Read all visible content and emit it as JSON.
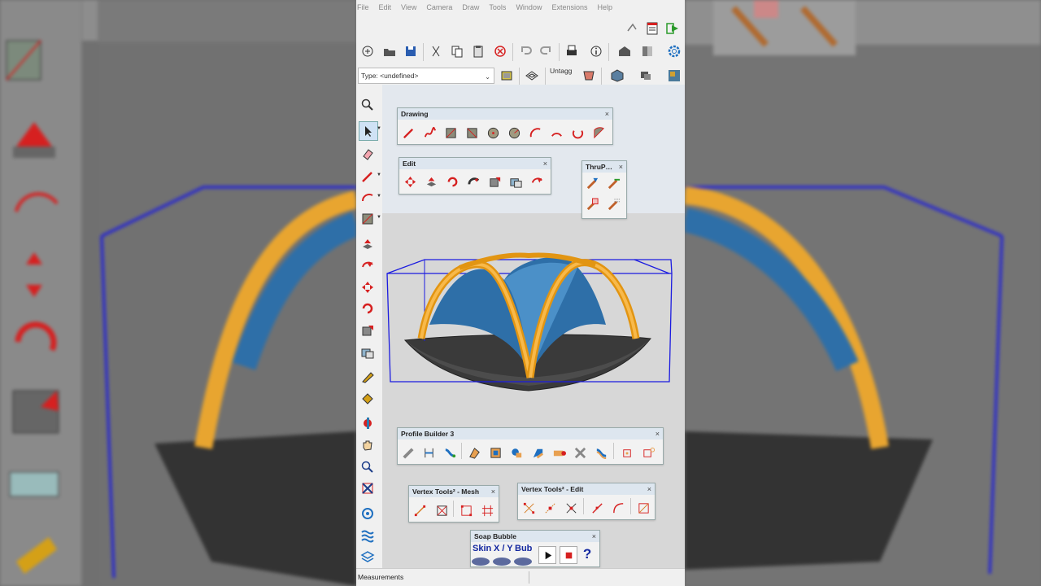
{
  "menu": [
    "File",
    "Edit",
    "View",
    "Camera",
    "Draw",
    "Tools",
    "Window",
    "Extensions",
    "Help"
  ],
  "type_selector": {
    "value": "Type: <undefined>"
  },
  "tag_selector": {
    "value": "Untagg"
  },
  "palettes": {
    "drawing": {
      "title": "Drawing",
      "close": "×"
    },
    "edit": {
      "title": "Edit",
      "close": "×"
    },
    "thrupaint": {
      "title": "ThruP…",
      "close": "×"
    },
    "profile_builder": {
      "title": "Profile Builder 3",
      "close": "×"
    },
    "vertex_mesh": {
      "title": "Vertex Tools² - Mesh",
      "close": "×"
    },
    "vertex_edit": {
      "title": "Vertex Tools² - Edit",
      "close": "×"
    },
    "soap_bubble": {
      "title": "Soap Bubble",
      "close": "×",
      "buttons": [
        "Skin",
        "X / Y",
        "Bub"
      ]
    }
  },
  "status": {
    "measurements_label": "Measurements"
  },
  "colors": {
    "accent_red": "#d62020",
    "arch_orange": "#f5a623",
    "canopy_blue": "#2e6fa8",
    "selection_blue": "#1b1be0"
  }
}
